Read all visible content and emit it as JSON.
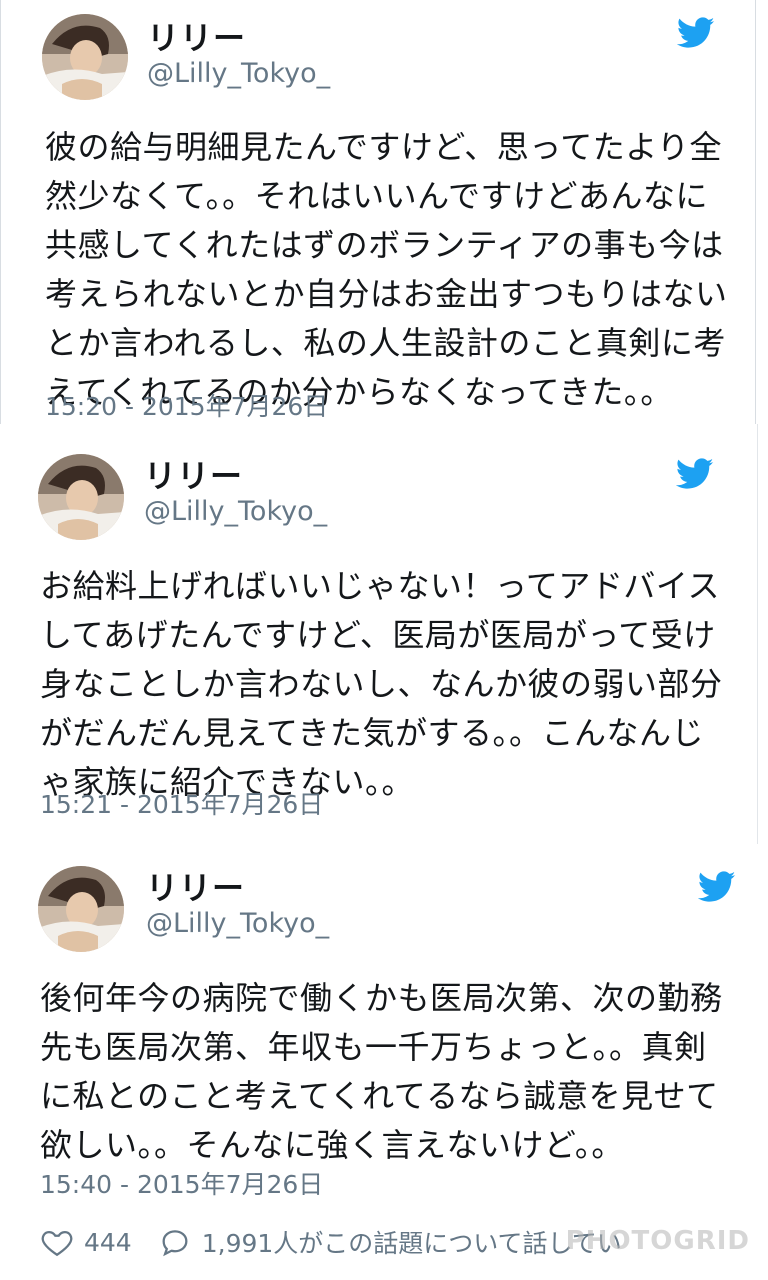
{
  "accent_color": "#1da1f2",
  "tweets": [
    {
      "name": "リリー",
      "handle": "@Lilly_Tokyo_",
      "lines": [
        "彼の給与明細見たんですけど、思ってたより全",
        "然少なくて。。それはいいんですけどあんなに",
        "共感してくれたはずのボランティアの事も今は",
        "考えられないとか自分はお金出すつもりはない",
        "とか言われるし、私の人生設計のこと真剣に考",
        "えてくれてるのか分からなくなってきた。。"
      ],
      "timestamp": "15:20 - 2015年7月26日"
    },
    {
      "name": "リリー",
      "handle": "@Lilly_Tokyo_",
      "lines": [
        "お給料上げればいいじゃない！ってアドバイス",
        "してあげたんですけど、医局が医局がって受け",
        "身なことしか言わないし、なんか彼の弱い部分",
        "がだんだん見えてきた気がする。。こんなんじ",
        "ゃ家族に紹介できない。。"
      ],
      "timestamp": "15:21 - 2015年7月26日"
    },
    {
      "name": "リリー",
      "handle": "@Lilly_Tokyo_",
      "lines": [
        "後何年今の病院で働くかも医局次第、次の勤務",
        "先も医局次第、年収も一千万ちょっと。。真剣",
        "に私とのこと考えてくれてるなら誠意を見せて",
        "欲しい。。そんなに強く言えないけど。。"
      ],
      "timestamp": "15:40 - 2015年7月26日"
    }
  ],
  "actions": {
    "likes_count": "444",
    "talk_text": "1,991人がこの話題について話してい",
    "like_icon": "heart-icon",
    "reply_icon": "speech-bubble-icon"
  },
  "watermark": "PHOTOGRID"
}
